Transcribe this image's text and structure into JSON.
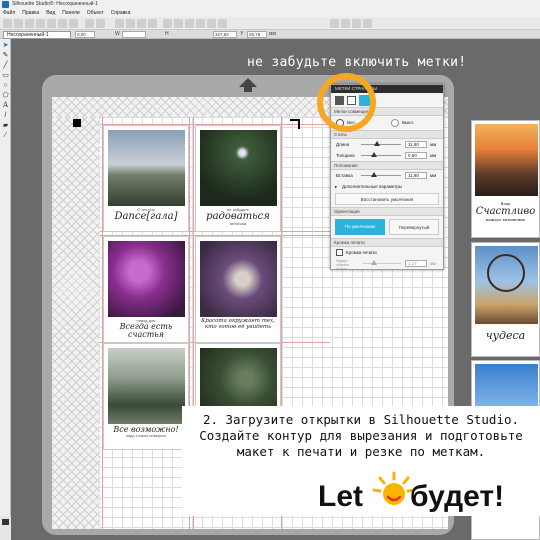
{
  "window": {
    "title": "Silhouette Studio®: Несохраненный-1"
  },
  "menubar": [
    "Файл",
    "Правка",
    "Вид",
    "Панели",
    "Объект",
    "Справка"
  ],
  "toolbar": {
    "field1": "0,00",
    "w_label": "W",
    "w_value": "",
    "h_label": "H",
    "x_value": "327,62",
    "y_label": "Y",
    "y_value": "25,76",
    "unit": "мм"
  },
  "document_tab": "Несохраненный-1",
  "hint_text": "не забудьте включить метки!",
  "panel": {
    "header": "МЕТКИ СТРАНИЦЫ",
    "section_alignment": "Метки совмещения",
    "mode_on": "Вкл.",
    "mode_off": "Выкл.",
    "section_style": "Стиль",
    "length_label": "Длина",
    "length_value": "11,80",
    "thickness_label": "Толщина",
    "thickness_value": "0,50",
    "unit": "мм",
    "section_position": "Положение",
    "inset_label": "Вставка",
    "inset_value": "11,80",
    "advanced_label": "Дополнительные параметры",
    "restore_button": "Восстановить умолчания",
    "section_orientation": "Ориентация",
    "default_button": "По умолчанию",
    "flipped_button": "Перевернутый",
    "section_print_border": "Кромка печати",
    "print_border_check": "Кромка печати",
    "bleed_label": "Радиус обрезки кромки",
    "bleed_value": "1,27"
  },
  "cards": [
    {
      "small": "С тех пор",
      "big": "Dance[гала]",
      "colors": [
        "#7a8fa8",
        "#c8ccd0",
        "#3b4a3a"
      ]
    },
    {
      "small": "не забудьте",
      "big": "радоваться",
      "extra": "мелочам",
      "colors": [
        "#1e2a1c",
        "#3e5c3a",
        "#c9d2bf"
      ]
    },
    {
      "small": "повод для",
      "big": "Всегда есть счастья",
      "colors": [
        "#3a1840",
        "#8a2e8e",
        "#c86ad0"
      ]
    },
    {
      "small": "",
      "big": "Красота окружает тех, кто готов её увидеть",
      "colors": [
        "#3b2a44",
        "#6b4c7a",
        "#d8d0c8"
      ]
    },
    {
      "small": "",
      "big": "Все возможно!",
      "extra": "надо только поверить",
      "colors": [
        "#6e7d6a",
        "#c8cfc6",
        "#2e3b2e"
      ]
    },
    {
      "small": "",
      "big": "",
      "colors": [
        "#1e2a1c",
        "#3a4e34",
        "#6a7e5e"
      ]
    }
  ],
  "right_cards": [
    {
      "small": "Ведь",
      "big": "Счастливо",
      "extra": "каждое мгновение"
    },
    {
      "big": "чудеса"
    },
    {
      "big": ""
    }
  ],
  "overlay": {
    "line1": "2. Загрузите открытки в Silhouette Studio.",
    "line2": "Создайте контур для вырезания и подготовьте",
    "line3": "макет к печати и резке по меткам."
  },
  "logo": {
    "part1": "Let",
    "part2": "будет!"
  },
  "colors": {
    "accent": "#2bb3dc",
    "ring": "#f7a823",
    "logo_red": "#e4322b",
    "logo_sun": "#f7b500"
  }
}
